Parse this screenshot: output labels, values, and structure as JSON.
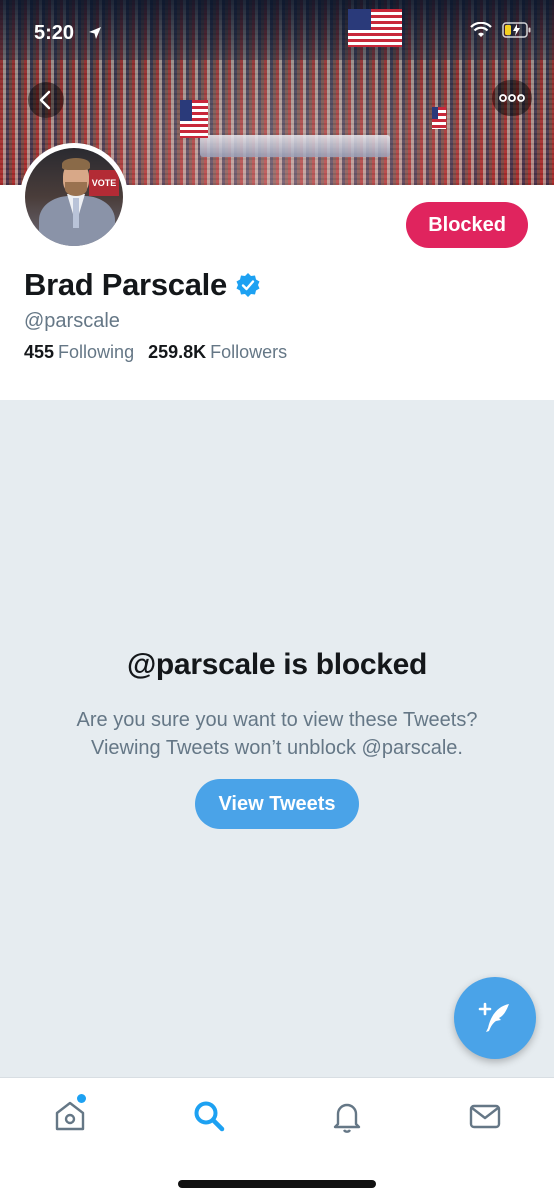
{
  "status_bar": {
    "time": "5:20"
  },
  "profile": {
    "name": "Brad Parscale",
    "handle": "@parscale",
    "blocked_label": "Blocked",
    "following_count": "455",
    "following_label": "Following",
    "followers_count": "259.8K",
    "followers_label": "Followers",
    "avatar_sign_text": "VOTE"
  },
  "blocked_notice": {
    "title": "@parscale is blocked",
    "line1": "Are you sure you want to view these Tweets?",
    "line2": "Viewing Tweets won’t unblock @parscale.",
    "button_label": "View Tweets"
  },
  "tabbar": {
    "items": [
      {
        "name": "home-icon",
        "active": false,
        "has_dot": true
      },
      {
        "name": "search-icon",
        "active": true
      },
      {
        "name": "bell-icon",
        "active": false
      },
      {
        "name": "mail-icon",
        "active": false
      }
    ]
  },
  "colors": {
    "accent": "#1da1f2",
    "button_blue": "#4aa3e8",
    "blocked_red": "#e0245e",
    "secondary_text": "#657786",
    "background": "#e6ecf0"
  }
}
